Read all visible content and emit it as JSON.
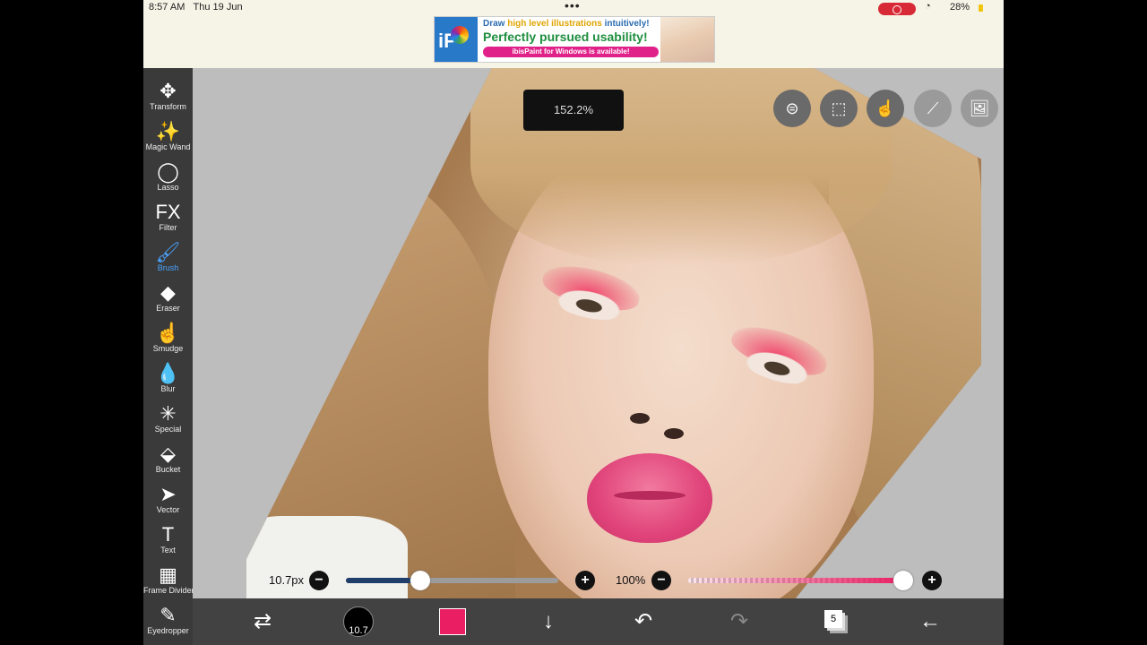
{
  "status_bar": {
    "time": "8:57 AM",
    "date": "Thu 19 Jun",
    "battery": "28%"
  },
  "ad": {
    "line1_a": "Draw ",
    "line1_highlight": "high level illustrations",
    "line1_b": " intuitively!",
    "line2": "Perfectly pursued usability!",
    "line3": "ibisPaint for Windows is available!",
    "logo_text": "iP"
  },
  "tools": [
    {
      "label": "Transform",
      "icon": "✥"
    },
    {
      "label": "Magic Wand",
      "icon": "✨"
    },
    {
      "label": "Lasso",
      "icon": "◯"
    },
    {
      "label": "Filter",
      "icon": "FX"
    },
    {
      "label": "Brush",
      "icon": "🖌"
    },
    {
      "label": "Eraser",
      "icon": "◆"
    },
    {
      "label": "Smudge",
      "icon": "☝"
    },
    {
      "label": "Blur",
      "icon": "💧"
    },
    {
      "label": "Special",
      "icon": "✳"
    },
    {
      "label": "Bucket",
      "icon": "⬙"
    },
    {
      "label": "Vector",
      "icon": "➤"
    },
    {
      "label": "Text",
      "icon": "T"
    },
    {
      "label": "Frame Divider",
      "icon": "▦"
    },
    {
      "label": "Eyedropper",
      "icon": "✎"
    }
  ],
  "active_tool": "Brush",
  "canvas": {
    "zoom": "152.2%"
  },
  "top_right_buttons": [
    {
      "icon": "toggle-icon",
      "glyph": "⊜"
    },
    {
      "icon": "selection-icon",
      "glyph": "⬚"
    },
    {
      "icon": "hand-icon",
      "glyph": "☝"
    },
    {
      "icon": "ruler-icon",
      "glyph": "⟋"
    },
    {
      "icon": "reference-image-icon",
      "glyph": "🖼"
    }
  ],
  "brush": {
    "size_label": "10.7px",
    "size_fraction": 0.35,
    "opacity_label": "100%",
    "opacity_fraction": 1.0,
    "minus": "−",
    "plus": "+"
  },
  "bottom_bar": {
    "brush_size_value": "10.7",
    "color": "#e91e63",
    "layer_count": "5",
    "glyphs": {
      "swap": "⇄",
      "down": "↓",
      "undo": "↶",
      "redo": "↷",
      "back": "←"
    }
  }
}
